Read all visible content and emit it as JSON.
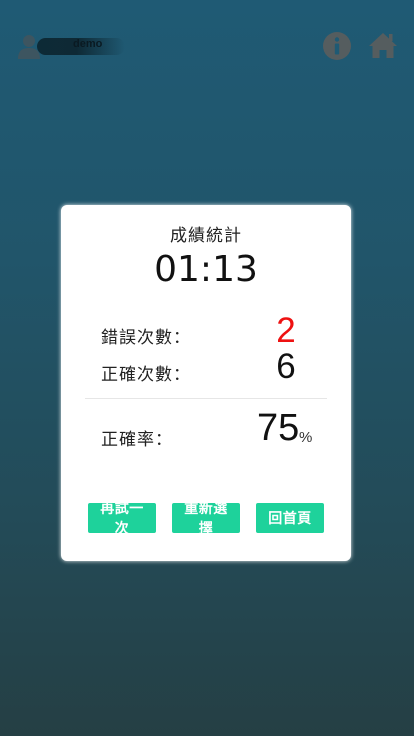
{
  "header": {
    "username": "demo",
    "icons": {
      "avatar": "user-avatar-icon",
      "info": "info-icon",
      "home": "home-icon"
    }
  },
  "result": {
    "title": "成績統計",
    "time": "01:13",
    "wrong_label": "錯誤次數：",
    "wrong_count": "2",
    "correct_label": "正確次數：",
    "correct_count": "6",
    "rate_label": "正確率：",
    "rate_value": "75",
    "rate_unit": "%"
  },
  "buttons": {
    "retry": "再試一次",
    "reselect": "重新選擇",
    "home": "回首頁"
  },
  "colors": {
    "accent": "#1ed29b",
    "error": "#ee1111"
  }
}
